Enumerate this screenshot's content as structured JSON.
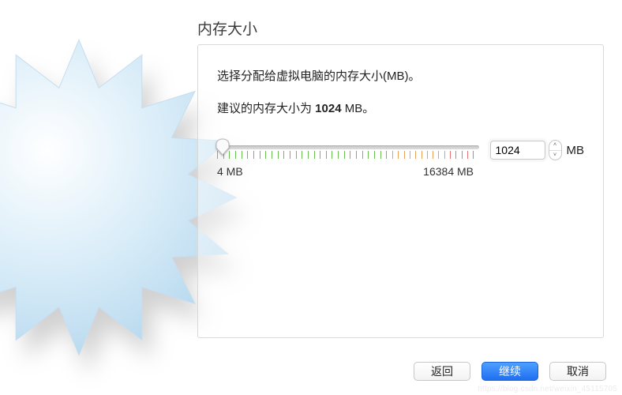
{
  "title": "内存大小",
  "description": "选择分配给虚拟电脑的内存大小(MB)。",
  "recommended": {
    "prefix": "建议的内存大小为 ",
    "value": "1024",
    "suffix": " MB。"
  },
  "slider": {
    "min_label": "4 MB",
    "max_label": "16384 MB",
    "value": "1024",
    "unit": "MB",
    "green_fraction": 0.67,
    "orange_fraction": 0.22,
    "red_fraction": 0.11,
    "knob_fraction": 0.02
  },
  "buttons": {
    "back": "返回",
    "continue": "继续",
    "cancel": "取消"
  },
  "watermark": "https://blog.csdn.net/weixin_45115705"
}
